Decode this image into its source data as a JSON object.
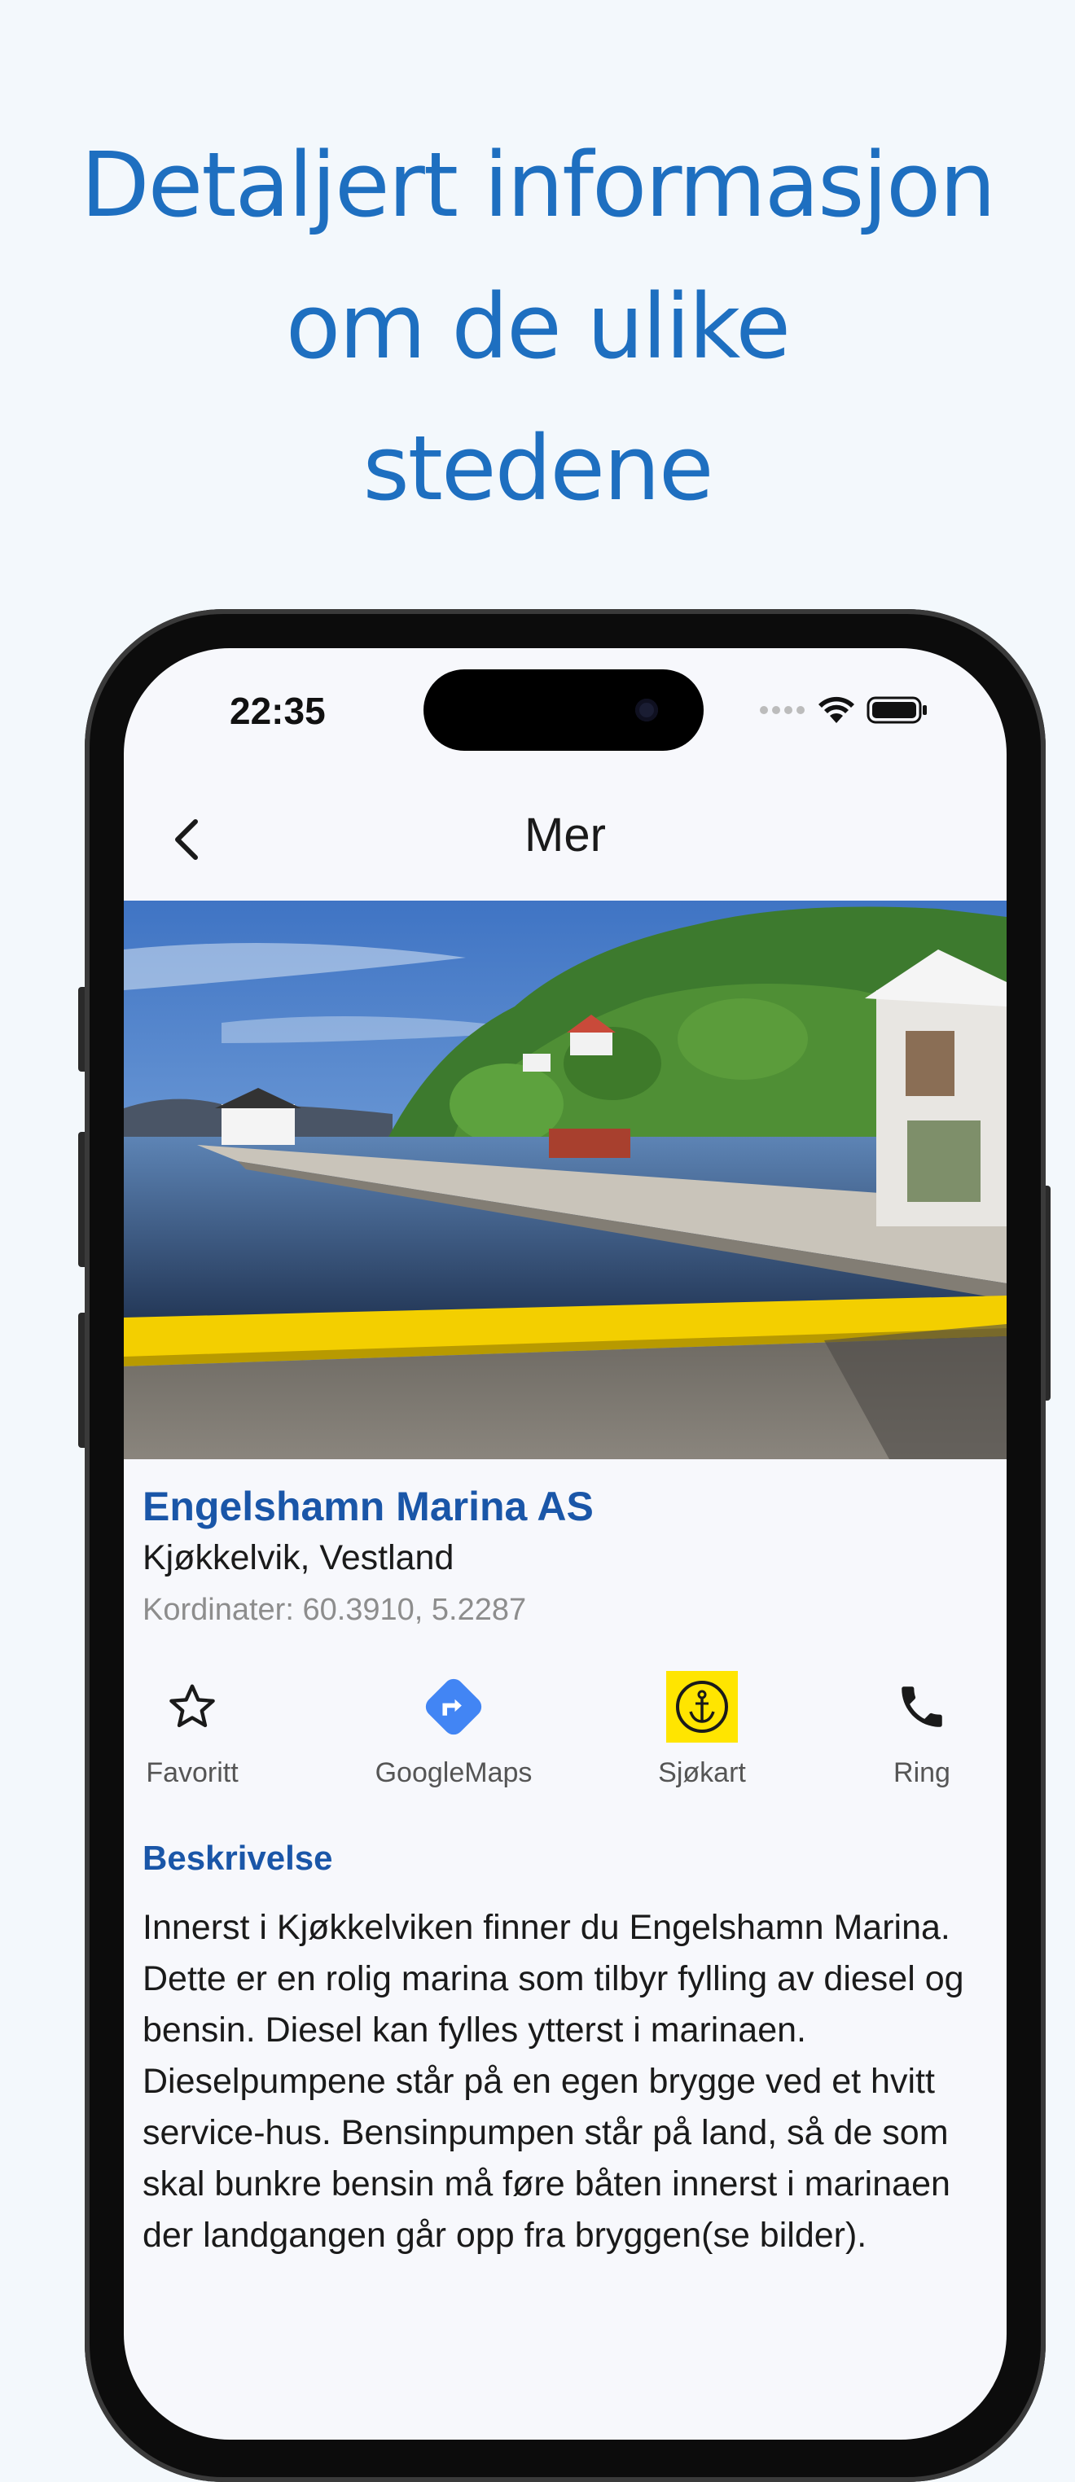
{
  "headline": {
    "lines": [
      "Detaljert informasjon",
      "om de ulike",
      "stedene"
    ]
  },
  "status_bar": {
    "time": "22:35"
  },
  "nav": {
    "title": "Mer"
  },
  "place": {
    "name": "Engelshamn Marina AS",
    "region": "Kjøkkelvik, Vestland",
    "coordinates": "Kordinater: 60.3910, 5.2287"
  },
  "actions": [
    {
      "label": "Favoritt",
      "icon": "star-outline-icon"
    },
    {
      "label": "GoogleMaps",
      "icon": "directions-icon"
    },
    {
      "label": "Sjøkart",
      "icon": "anchor-icon"
    },
    {
      "label": "Ring",
      "icon": "phone-icon"
    }
  ],
  "description": {
    "title": "Beskrivelse",
    "text": "Innerst i Kjøkkelviken finner du Engelshamn Marina. Dette er en rolig marina som tilbyr fylling av diesel og bensin. Diesel kan fylles ytterst i marinaen. Dieselpumpene står på en egen brygge ved et hvitt service-hus. Bensinpumpen står på land, så de som skal bunkre bensin må føre båten innerst i marinaen der landgangen går opp fra bryggen(se bilder)."
  },
  "colors": {
    "headline": "#1e6fc0",
    "accent": "#1a56a8",
    "maps_blue": "#4285f4",
    "sjokart_yellow": "#ffe500"
  }
}
